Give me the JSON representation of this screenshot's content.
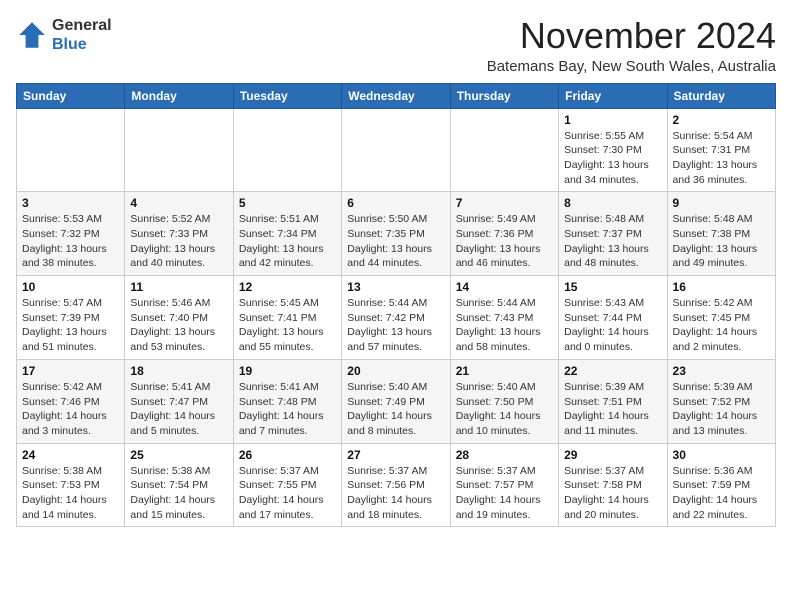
{
  "logo": {
    "general": "General",
    "blue": "Blue"
  },
  "header": {
    "month_title": "November 2024",
    "location": "Batemans Bay, New South Wales, Australia"
  },
  "weekdays": [
    "Sunday",
    "Monday",
    "Tuesday",
    "Wednesday",
    "Thursday",
    "Friday",
    "Saturday"
  ],
  "weeks": [
    [
      {
        "day": "",
        "info": ""
      },
      {
        "day": "",
        "info": ""
      },
      {
        "day": "",
        "info": ""
      },
      {
        "day": "",
        "info": ""
      },
      {
        "day": "",
        "info": ""
      },
      {
        "day": "1",
        "info": "Sunrise: 5:55 AM\nSunset: 7:30 PM\nDaylight: 13 hours\nand 34 minutes."
      },
      {
        "day": "2",
        "info": "Sunrise: 5:54 AM\nSunset: 7:31 PM\nDaylight: 13 hours\nand 36 minutes."
      }
    ],
    [
      {
        "day": "3",
        "info": "Sunrise: 5:53 AM\nSunset: 7:32 PM\nDaylight: 13 hours\nand 38 minutes."
      },
      {
        "day": "4",
        "info": "Sunrise: 5:52 AM\nSunset: 7:33 PM\nDaylight: 13 hours\nand 40 minutes."
      },
      {
        "day": "5",
        "info": "Sunrise: 5:51 AM\nSunset: 7:34 PM\nDaylight: 13 hours\nand 42 minutes."
      },
      {
        "day": "6",
        "info": "Sunrise: 5:50 AM\nSunset: 7:35 PM\nDaylight: 13 hours\nand 44 minutes."
      },
      {
        "day": "7",
        "info": "Sunrise: 5:49 AM\nSunset: 7:36 PM\nDaylight: 13 hours\nand 46 minutes."
      },
      {
        "day": "8",
        "info": "Sunrise: 5:48 AM\nSunset: 7:37 PM\nDaylight: 13 hours\nand 48 minutes."
      },
      {
        "day": "9",
        "info": "Sunrise: 5:48 AM\nSunset: 7:38 PM\nDaylight: 13 hours\nand 49 minutes."
      }
    ],
    [
      {
        "day": "10",
        "info": "Sunrise: 5:47 AM\nSunset: 7:39 PM\nDaylight: 13 hours\nand 51 minutes."
      },
      {
        "day": "11",
        "info": "Sunrise: 5:46 AM\nSunset: 7:40 PM\nDaylight: 13 hours\nand 53 minutes."
      },
      {
        "day": "12",
        "info": "Sunrise: 5:45 AM\nSunset: 7:41 PM\nDaylight: 13 hours\nand 55 minutes."
      },
      {
        "day": "13",
        "info": "Sunrise: 5:44 AM\nSunset: 7:42 PM\nDaylight: 13 hours\nand 57 minutes."
      },
      {
        "day": "14",
        "info": "Sunrise: 5:44 AM\nSunset: 7:43 PM\nDaylight: 13 hours\nand 58 minutes."
      },
      {
        "day": "15",
        "info": "Sunrise: 5:43 AM\nSunset: 7:44 PM\nDaylight: 14 hours\nand 0 minutes."
      },
      {
        "day": "16",
        "info": "Sunrise: 5:42 AM\nSunset: 7:45 PM\nDaylight: 14 hours\nand 2 minutes."
      }
    ],
    [
      {
        "day": "17",
        "info": "Sunrise: 5:42 AM\nSunset: 7:46 PM\nDaylight: 14 hours\nand 3 minutes."
      },
      {
        "day": "18",
        "info": "Sunrise: 5:41 AM\nSunset: 7:47 PM\nDaylight: 14 hours\nand 5 minutes."
      },
      {
        "day": "19",
        "info": "Sunrise: 5:41 AM\nSunset: 7:48 PM\nDaylight: 14 hours\nand 7 minutes."
      },
      {
        "day": "20",
        "info": "Sunrise: 5:40 AM\nSunset: 7:49 PM\nDaylight: 14 hours\nand 8 minutes."
      },
      {
        "day": "21",
        "info": "Sunrise: 5:40 AM\nSunset: 7:50 PM\nDaylight: 14 hours\nand 10 minutes."
      },
      {
        "day": "22",
        "info": "Sunrise: 5:39 AM\nSunset: 7:51 PM\nDaylight: 14 hours\nand 11 minutes."
      },
      {
        "day": "23",
        "info": "Sunrise: 5:39 AM\nSunset: 7:52 PM\nDaylight: 14 hours\nand 13 minutes."
      }
    ],
    [
      {
        "day": "24",
        "info": "Sunrise: 5:38 AM\nSunset: 7:53 PM\nDaylight: 14 hours\nand 14 minutes."
      },
      {
        "day": "25",
        "info": "Sunrise: 5:38 AM\nSunset: 7:54 PM\nDaylight: 14 hours\nand 15 minutes."
      },
      {
        "day": "26",
        "info": "Sunrise: 5:37 AM\nSunset: 7:55 PM\nDaylight: 14 hours\nand 17 minutes."
      },
      {
        "day": "27",
        "info": "Sunrise: 5:37 AM\nSunset: 7:56 PM\nDaylight: 14 hours\nand 18 minutes."
      },
      {
        "day": "28",
        "info": "Sunrise: 5:37 AM\nSunset: 7:57 PM\nDaylight: 14 hours\nand 19 minutes."
      },
      {
        "day": "29",
        "info": "Sunrise: 5:37 AM\nSunset: 7:58 PM\nDaylight: 14 hours\nand 20 minutes."
      },
      {
        "day": "30",
        "info": "Sunrise: 5:36 AM\nSunset: 7:59 PM\nDaylight: 14 hours\nand 22 minutes."
      }
    ]
  ]
}
